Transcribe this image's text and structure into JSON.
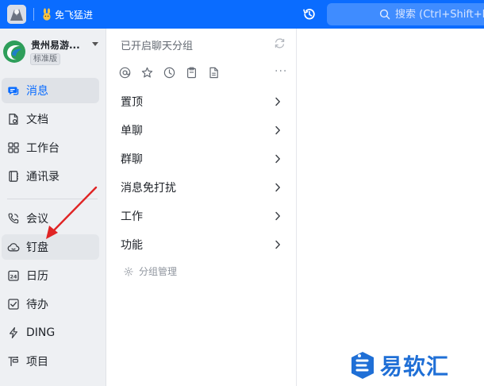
{
  "topbar": {
    "promo_text": "免飞猛进",
    "search_placeholder": "搜索 (Ctrl+Shift+F)",
    "background_color": "#0a6cff"
  },
  "org": {
    "name": "贵州易游...",
    "badge": "标准版"
  },
  "sidebar": {
    "items": [
      {
        "label": "消息",
        "icon": "message-icon",
        "active": true
      },
      {
        "label": "文档",
        "icon": "document-icon"
      },
      {
        "label": "工作台",
        "icon": "grid-icon"
      },
      {
        "label": "通讯录",
        "icon": "contacts-icon"
      },
      {
        "label": "会议",
        "icon": "phone-icon"
      },
      {
        "label": "钉盘",
        "icon": "cloud-icon",
        "highlighted": true
      },
      {
        "label": "日历",
        "icon": "calendar-icon"
      },
      {
        "label": "待办",
        "icon": "checkbox-icon"
      },
      {
        "label": "DING",
        "icon": "lightning-icon"
      },
      {
        "label": "项目",
        "icon": "project-icon"
      }
    ],
    "accent_color": "#0a6cff"
  },
  "middle": {
    "header": "已开启聊天分组",
    "quick_icons": [
      "at-icon",
      "star-icon",
      "clock-icon",
      "clipboard-icon",
      "file-icon",
      "more-icon"
    ],
    "groups": [
      {
        "label": "置顶"
      },
      {
        "label": "单聊"
      },
      {
        "label": "群聊"
      },
      {
        "label": "消息免打扰"
      },
      {
        "label": "工作"
      },
      {
        "label": "功能"
      }
    ],
    "manage_label": "分组管理"
  },
  "watermark": {
    "text": "易软汇"
  }
}
